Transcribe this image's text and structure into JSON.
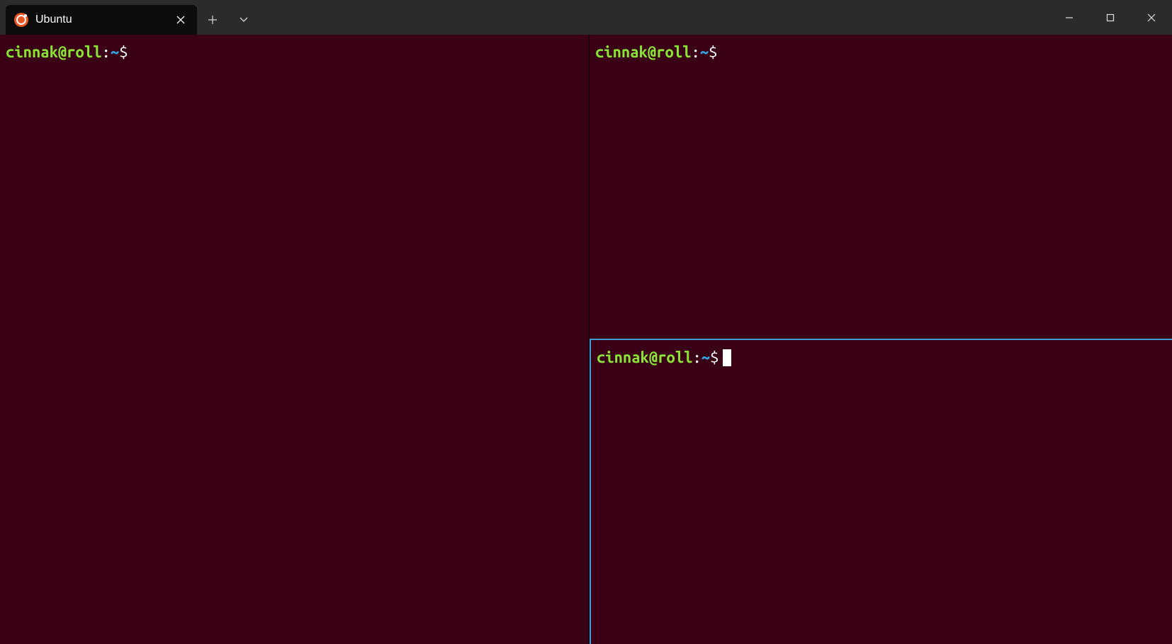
{
  "titlebar": {
    "tab": {
      "title": "Ubuntu",
      "icon": "ubuntu-logo"
    },
    "new_tab_icon": "plus-icon",
    "dropdown_icon": "chevron-down-icon"
  },
  "colors": {
    "terminal_bg": "#3a0016",
    "prompt_user": "#8ae234",
    "prompt_path": "#34a3dd",
    "active_pane_border": "#3a9fd6",
    "titlebar_bg": "#2b2b2b",
    "tab_bg": "#0c0c0c"
  },
  "panes": {
    "left": {
      "prompt_user_host": "cinnak@roll",
      "prompt_separator": ":",
      "prompt_path": "~",
      "prompt_symbol": "$",
      "has_cursor": false
    },
    "right_top": {
      "prompt_user_host": "cinnak@roll",
      "prompt_separator": ":",
      "prompt_path": "~",
      "prompt_symbol": "$",
      "has_cursor": false
    },
    "right_bottom": {
      "prompt_user_host": "cinnak@roll",
      "prompt_separator": ":",
      "prompt_path": "~",
      "prompt_symbol": "$",
      "has_cursor": true,
      "active": true
    }
  }
}
